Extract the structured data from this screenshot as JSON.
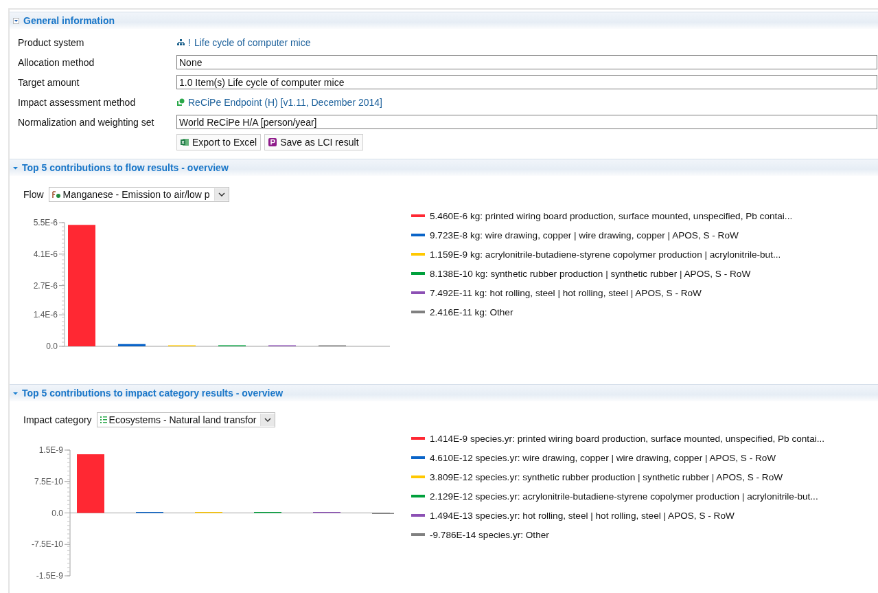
{
  "general_information": {
    "title": "General information",
    "expanded": true,
    "kind": "box",
    "fields": [
      {
        "kind": "product_link",
        "label": "Product system",
        "marker": "!",
        "value": "Life cycle of computer mice"
      },
      {
        "kind": "text_field",
        "label": "Allocation method",
        "value": "None"
      },
      {
        "kind": "text_field",
        "label": "Target amount",
        "value": "1.0 Item(s) Life cycle of computer mice"
      },
      {
        "kind": "method_link",
        "label": "Impact assessment method",
        "value": "ReCiPe Endpoint (H) [v1.11,  December 2014]"
      },
      {
        "kind": "text_field",
        "label": "Normalization and weighting set",
        "value": "World ReCiPe H/A [person/year]"
      }
    ],
    "buttons": [
      {
        "kind": "excel",
        "label": "Export to Excel"
      },
      {
        "kind": "lci",
        "label": "Save as LCI result"
      }
    ]
  },
  "sections": [
    {
      "title": "Top 5 contributions to flow results - overview",
      "expanded": true,
      "kind": "arrow",
      "selector": {
        "kind": "flow",
        "label": "Flow",
        "value": "Manganese - Emission to air/low p"
      },
      "chart_data": {
        "type": "bar",
        "values": [
          5.4e-06,
          1e-07,
          1e-09,
          8e-10,
          7e-11,
          2e-11
        ],
        "ylim": [
          0,
          5.5e-06
        ],
        "yticks": [
          {
            "value": 0,
            "label": "0.0"
          },
          {
            "value": 1.4e-06,
            "label": "1.4E-6"
          },
          {
            "value": 2.7e-06,
            "label": "2.7E-6"
          },
          {
            "value": 4.1e-06,
            "label": "4.1E-6"
          },
          {
            "value": 5.5e-06,
            "label": "5.5E-6"
          }
        ]
      },
      "legend": [
        {
          "text": "5.460E-6 kg: printed wiring board production, surface mounted, unspecified, Pb contai...",
          "color": "#ff2833"
        },
        {
          "text": "9.723E-8 kg: wire drawing, copper | wire drawing, copper | APOS, S - RoW",
          "color": "#0a64c8"
        },
        {
          "text": "1.159E-9 kg: acrylonitrile-butadiene-styrene copolymer production | acrylonitrile-but...",
          "color": "#ffc800"
        },
        {
          "text": "8.138E-10 kg: synthetic rubber production | synthetic rubber | APOS, S - RoW",
          "color": "#00a03c"
        },
        {
          "text": "7.492E-11 kg: hot rolling, steel | hot rolling, steel | APOS, S - RoW",
          "color": "#8c50b4"
        },
        {
          "text": "2.416E-11 kg: Other",
          "color": "#808080"
        }
      ]
    },
    {
      "title": "Top 5 contributions to impact category results - overview",
      "expanded": true,
      "kind": "arrow",
      "selector": {
        "kind": "impact",
        "label": "Impact category",
        "value": "Ecosystems - Natural land transfor"
      },
      "chart_data": {
        "type": "bar",
        "values": [
          1.4e-09,
          5e-12,
          4e-12,
          2e-12,
          1e-13,
          -1e-13
        ],
        "ylim": [
          -1.5e-09,
          1.5e-09
        ],
        "yticks": [
          {
            "value": -1.5e-09,
            "label": "-1.5E-9"
          },
          {
            "value": -7.5e-10,
            "label": "-7.5E-10"
          },
          {
            "value": 0,
            "label": "0.0"
          },
          {
            "value": 7.5e-10,
            "label": "7.5E-10"
          },
          {
            "value": 1.5e-09,
            "label": "1.5E-9"
          }
        ]
      },
      "legend": [
        {
          "text": "1.414E-9 species.yr: printed wiring board production, surface mounted, unspecified, Pb contai...",
          "color": "#ff2833"
        },
        {
          "text": "4.610E-12 species.yr: wire drawing, copper | wire drawing, copper | APOS, S - RoW",
          "color": "#0a64c8"
        },
        {
          "text": "3.809E-12 species.yr: synthetic rubber production | synthetic rubber | APOS, S - RoW",
          "color": "#ffc800"
        },
        {
          "text": "2.129E-12 species.yr: acrylonitrile-butadiene-styrene copolymer production | acrylonitrile-but...",
          "color": "#00a03c"
        },
        {
          "text": "1.494E-13 species.yr: hot rolling, steel | hot rolling, steel | APOS, S - RoW",
          "color": "#8c50b4"
        },
        {
          "text": "-9.786E-14 species.yr: Other",
          "color": "#808080"
        }
      ]
    }
  ]
}
